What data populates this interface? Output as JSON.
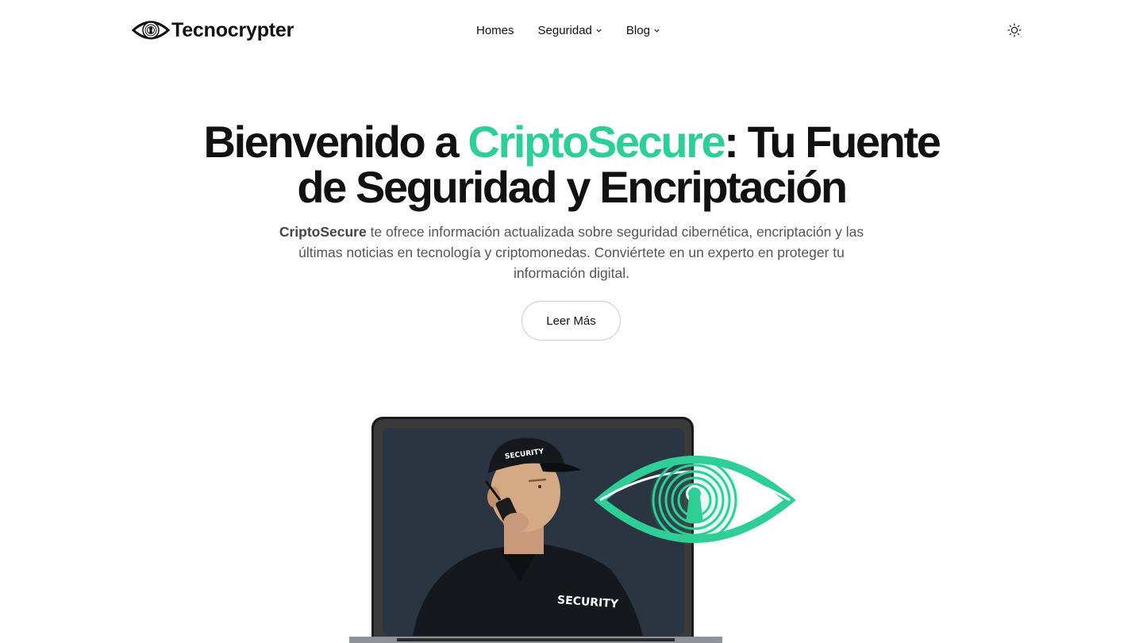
{
  "header": {
    "logo_text": "Tecnocrypter",
    "nav": [
      {
        "label": "Homes",
        "has_dropdown": false
      },
      {
        "label": "Seguridad",
        "has_dropdown": true
      },
      {
        "label": "Blog",
        "has_dropdown": true
      }
    ],
    "theme_toggle_icon": "sun-icon"
  },
  "hero": {
    "title_part1": "Bienvenido a ",
    "title_accent": "CriptoSecure",
    "title_part2": ": Tu Fuente",
    "title_line2": "de Seguridad y Encriptación",
    "desc_strong": "CriptoSecure",
    "desc_text": " te ofrece información actualizada sobre seguridad cibernética, encriptación y las últimas noticias en tecnología y criptomonedas. Conviértete en un experto en proteger tu información digital.",
    "cta_label": "Leer Más",
    "image_badge_text": "SECURITY",
    "image_cap_text": "SECURITY"
  },
  "colors": {
    "accent": "#2ecf97",
    "text": "#111111",
    "muted": "#555555",
    "screen": "#2b3542"
  }
}
